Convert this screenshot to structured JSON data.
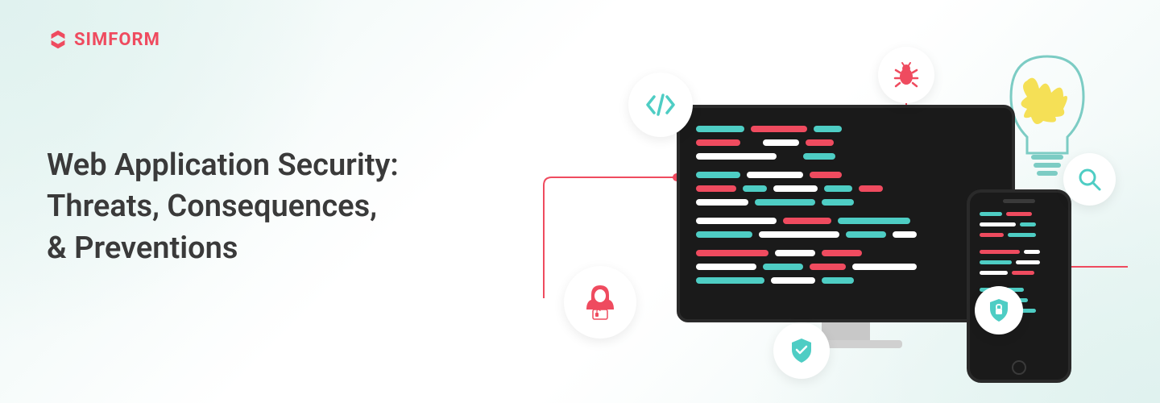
{
  "brand": {
    "name": "SIMFORM",
    "color": "#ef4b5f"
  },
  "heading": {
    "line1": "Web Application Security:",
    "line2": "Threats, Consequences,",
    "line3": "& Preventions"
  },
  "icons": {
    "code": "code-icon",
    "bug": "bug-icon",
    "search": "search-icon",
    "hacker": "hacker-icon",
    "shield_check": "shield-check-icon",
    "shield_lock": "shield-lock-icon",
    "lightbulb": "lightbulb-icon"
  },
  "colors": {
    "teal": "#4ecdc4",
    "red": "#ef4b5f",
    "white": "#ffffff",
    "dark": "#1a1a1a",
    "text": "#3a3a3a"
  }
}
